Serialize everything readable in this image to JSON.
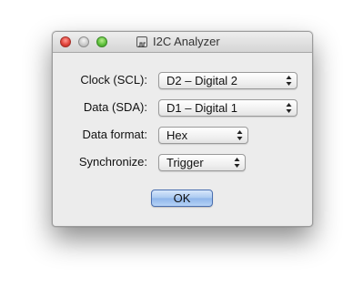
{
  "window": {
    "title": "I2C Analyzer"
  },
  "form": {
    "clock": {
      "label": "Clock (SCL):",
      "value": "D2 – Digital 2"
    },
    "data": {
      "label": "Data (SDA):",
      "value": "D1 – Digital 1"
    },
    "data_format": {
      "label": "Data format:",
      "value": "Hex"
    },
    "synchronize": {
      "label": "Synchronize:",
      "value": "Trigger"
    }
  },
  "buttons": {
    "ok_label": "OK"
  }
}
